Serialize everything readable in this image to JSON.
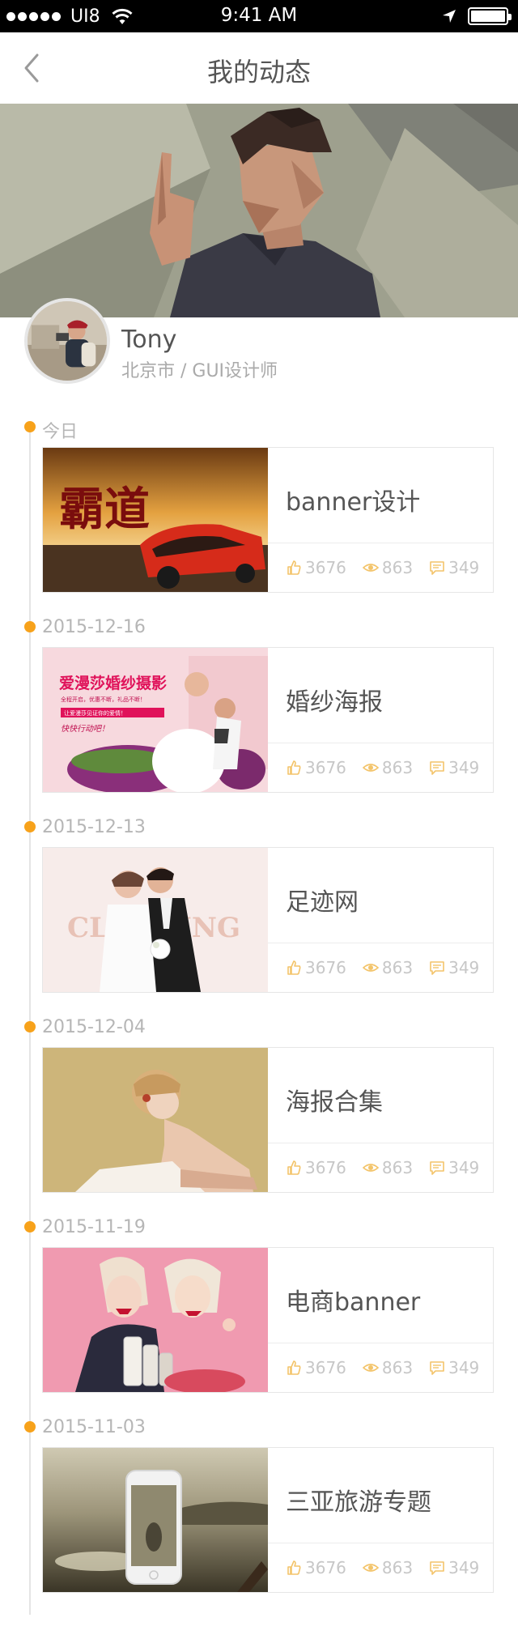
{
  "status_bar": {
    "carrier": "UI8",
    "time": "9:41 AM",
    "icons": [
      "signal-dots-icon",
      "wifi-icon",
      "location-arrow-icon",
      "battery-icon"
    ]
  },
  "nav": {
    "title": "我的动态",
    "back_icon": "chevron-left-icon"
  },
  "profile": {
    "name": "Tony",
    "subtitle": "北京市 / GUI设计师"
  },
  "colors": {
    "accent": "#f7a21b",
    "stat_icon": "#f3c46a",
    "muted_text": "#b6b6b6"
  },
  "posts": [
    {
      "date": "今日",
      "title": "banner设计",
      "likes": "3676",
      "views": "863",
      "comments": "349"
    },
    {
      "date": "2015-12-16",
      "title": "婚纱海报",
      "likes": "3676",
      "views": "863",
      "comments": "349"
    },
    {
      "date": "2015-12-13",
      "title": "足迹网",
      "likes": "3676",
      "views": "863",
      "comments": "349"
    },
    {
      "date": "2015-12-04",
      "title": "海报合集",
      "likes": "3676",
      "views": "863",
      "comments": "349"
    },
    {
      "date": "2015-11-19",
      "title": "电商banner",
      "likes": "3676",
      "views": "863",
      "comments": "349"
    },
    {
      "date": "2015-11-03",
      "title": "三亚旅游专题",
      "likes": "3676",
      "views": "863",
      "comments": "349"
    }
  ],
  "thumbnails": {
    "0": {
      "logo_text": "霸道"
    },
    "1": {
      "headline": "爱漫莎婚纱摄影",
      "tagline": "全程开启，优惠不断，礼品不断！",
      "ribbon": "让爱漫莎见证你的爱情！",
      "slogan": "快快行动吧！"
    },
    "2": {
      "watermark": "CLOTHING"
    }
  }
}
